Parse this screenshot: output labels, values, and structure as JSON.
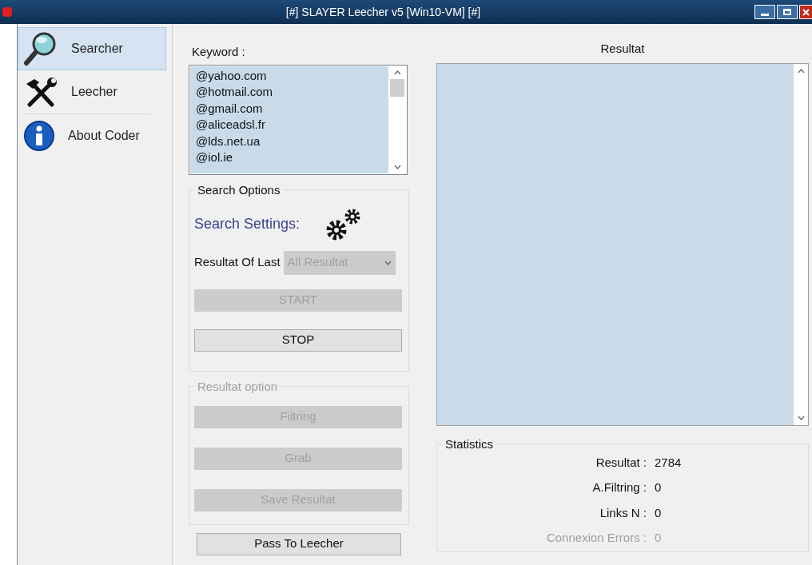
{
  "window": {
    "title": "[#] SLAYER Leecher v5 [Win10-VM] [#]"
  },
  "sidebar": {
    "items": [
      {
        "label": "Searcher",
        "kind": "search",
        "selected": true
      },
      {
        "label": "Leecher",
        "kind": "tools",
        "selected": false
      },
      {
        "label": "About Coder",
        "kind": "info",
        "selected": false
      }
    ]
  },
  "keyword": {
    "label": "Keyword :",
    "items": [
      "@yahoo.com",
      "@hotmail.com",
      "@gmail.com",
      "@aliceadsl.fr",
      "@lds.net.ua",
      "@iol.ie"
    ]
  },
  "search_options": {
    "title": "Search Options",
    "settings_label": "Search Settings:",
    "last_label": "Resultat Of Last",
    "last_value": "All Resultat",
    "last_disabled": true,
    "buttons": [
      {
        "label": "START",
        "disabled": true
      },
      {
        "label": "STOP",
        "disabled": false
      }
    ]
  },
  "resultat_option": {
    "title": "Resultat option",
    "disabled": true,
    "buttons": [
      {
        "label": "Filtring",
        "disabled": true
      },
      {
        "label": "Grab",
        "disabled": true
      },
      {
        "label": "Save Resultat",
        "disabled": true
      }
    ]
  },
  "pass_button": {
    "label": "Pass To Leecher",
    "disabled": false
  },
  "results": {
    "title": "Resultat"
  },
  "statistics": {
    "title": "Statistics",
    "rows": [
      {
        "label": "Resultat :",
        "value": "2784",
        "disabled": false
      },
      {
        "label": "A.Filtring :",
        "value": "0",
        "disabled": false
      },
      {
        "label": "Links N :",
        "value": "0",
        "disabled": false
      },
      {
        "label": "Connexion Errors :",
        "value": "0",
        "disabled": true
      }
    ]
  }
}
